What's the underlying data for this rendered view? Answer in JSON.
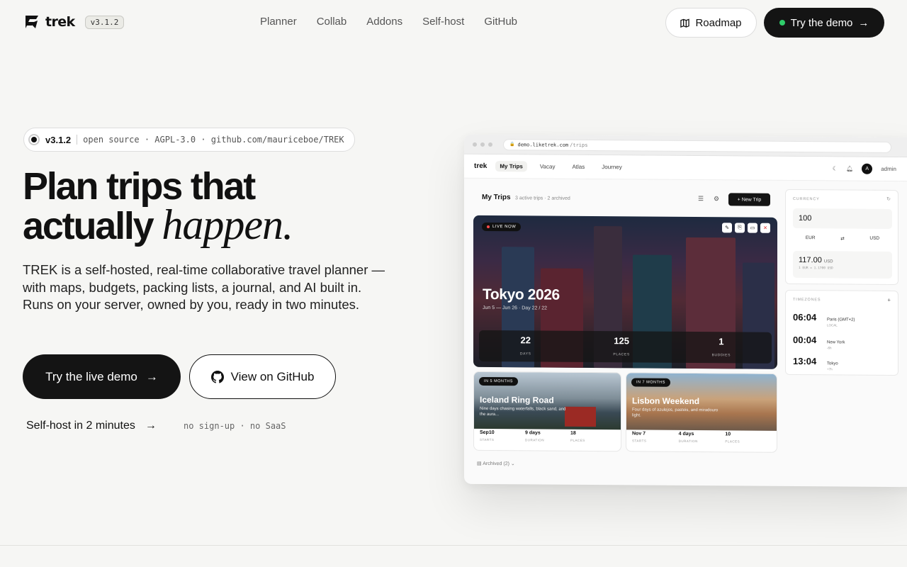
{
  "brand": {
    "name": "trek",
    "version": "v3.1.2"
  },
  "nav": {
    "links": [
      "Planner",
      "Collab",
      "Addons",
      "Self-host",
      "GitHub"
    ],
    "roadmap_label": "Roadmap",
    "demo_label": "Try the demo"
  },
  "hero": {
    "pill_version": "v3.1.2",
    "pill_text": "open source · AGPL-3.0 · github.com/mauriceboe/TREK",
    "title_line1": "Plan trips that",
    "title_line2": "actually",
    "title_italic": "happen.",
    "lede": "TREK is a self-hosted, real-time collaborative travel planner — with maps, budgets, packing lists, a journal, and AI built in. Runs on your server, owned by you, ready in two minutes.",
    "cta_primary": "Try the live demo",
    "cta_secondary": "View on GitHub",
    "selfhost_link": "Self-host in 2 minutes",
    "note": "no sign-up · no SaaS"
  },
  "mockup": {
    "url_host": "demo.liketrek.com",
    "url_path": "/trips",
    "app_logo": "trek",
    "tabs": [
      "My Trips",
      "Vacay",
      "Atlas",
      "Journey"
    ],
    "user": "admin",
    "avatar_letter": "A",
    "page_title": "My Trips",
    "page_sub": "3 active trips · 2 archived",
    "new_trip": "+ New Trip",
    "featured": {
      "badge": "LIVE NOW",
      "title": "Tokyo 2026",
      "dates": "Jun 5 — Jun 26 · Day 22 / 22",
      "stats": [
        {
          "value": "22",
          "label": "DAYS"
        },
        {
          "value": "125",
          "label": "PLACES"
        },
        {
          "value": "1",
          "label": "BUDDIES"
        }
      ]
    },
    "cards": [
      {
        "badge": "IN 5 MONTHS",
        "title": "Iceland Ring Road",
        "desc": "Nine days chasing waterfalls, black sand, and the aura...",
        "stats": [
          {
            "value": "Sep10",
            "label": "STARTS"
          },
          {
            "value": "9 days",
            "label": "DURATION"
          },
          {
            "value": "18",
            "label": "PLACES"
          }
        ]
      },
      {
        "badge": "IN 7 MONTHS",
        "title": "Lisbon Weekend",
        "desc": "Four days of azulejos, pasteis, and miradouro light.",
        "stats": [
          {
            "value": "Nov 7",
            "label": "STARTS"
          },
          {
            "value": "4 days",
            "label": "DURATION"
          },
          {
            "value": "10",
            "label": "PLACES"
          }
        ]
      }
    ],
    "archived": "Archived (2)",
    "currency": {
      "header": "CURRENCY",
      "amount": "100",
      "from": "EUR",
      "to": "USD",
      "result": "117.00",
      "result_unit": "USD",
      "rate": "1 EUR = 1.1700 USD"
    },
    "timezones": {
      "header": "TIMEZONES",
      "items": [
        {
          "time": "06:04",
          "city": "Paris (GMT+2)",
          "sub": "LOCAL"
        },
        {
          "time": "00:04",
          "city": "New York",
          "sub": "-6h"
        },
        {
          "time": "13:04",
          "city": "Tokyo",
          "sub": "+7h"
        }
      ]
    }
  }
}
